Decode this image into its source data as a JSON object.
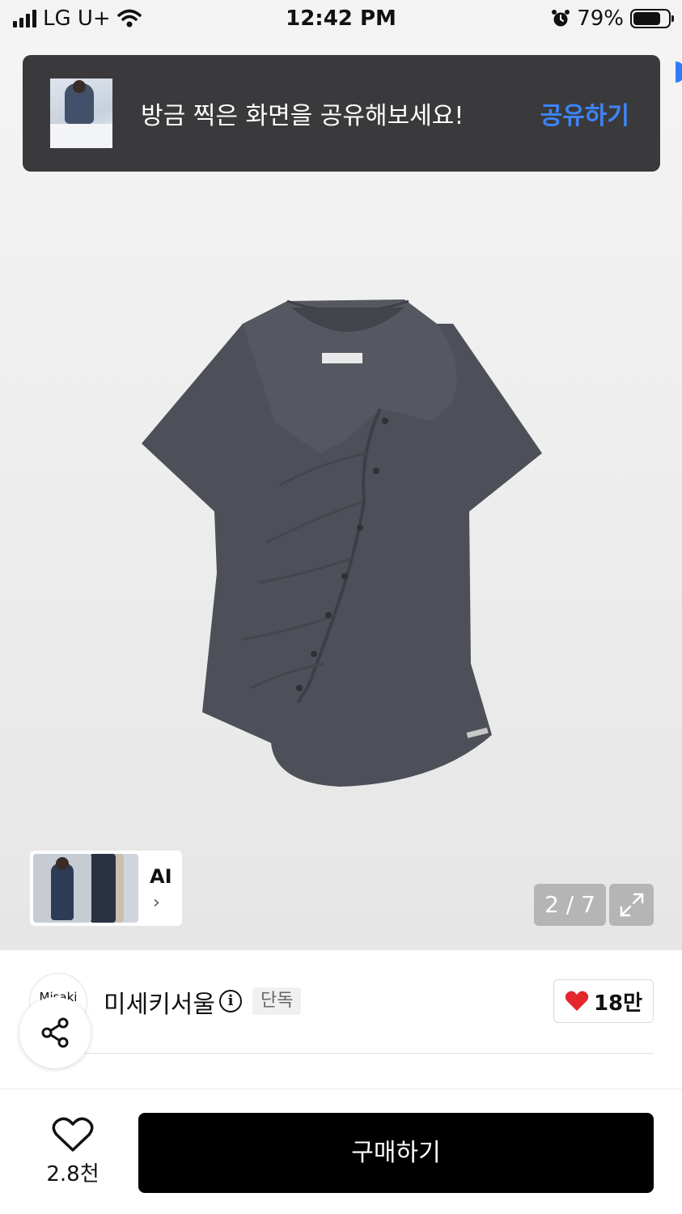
{
  "status_bar": {
    "carrier": "LG U+",
    "time": "12:42 PM",
    "battery": "79%",
    "battery_level": 0.79
  },
  "toast": {
    "message": "방금 찍은 화면을 공유해보세요!",
    "action": "공유하기"
  },
  "gallery": {
    "ai_label": "AI",
    "ai_chevron": "›",
    "page_indicator": "2 / 7"
  },
  "product": {
    "brand_logo": "Misaki",
    "brand_name": "미세키서울",
    "info_icon": "i",
    "exclusive_badge": "단독",
    "likes": "18만"
  },
  "bottom_bar": {
    "wish_count": "2.8천",
    "buy_label": "구매하기"
  },
  "colors": {
    "toast_bg": "#3a3a3c",
    "toast_action": "#3e84f7",
    "heart": "#e4262f",
    "buy_bg": "#000000",
    "shirt": "#4d5058"
  },
  "icons": [
    "signal-icon",
    "wifi-icon",
    "alarm-icon",
    "battery-icon",
    "expand-icon",
    "heart-icon",
    "share-icon",
    "wishlist-heart-icon",
    "chevron-right-icon",
    "info-icon"
  ]
}
